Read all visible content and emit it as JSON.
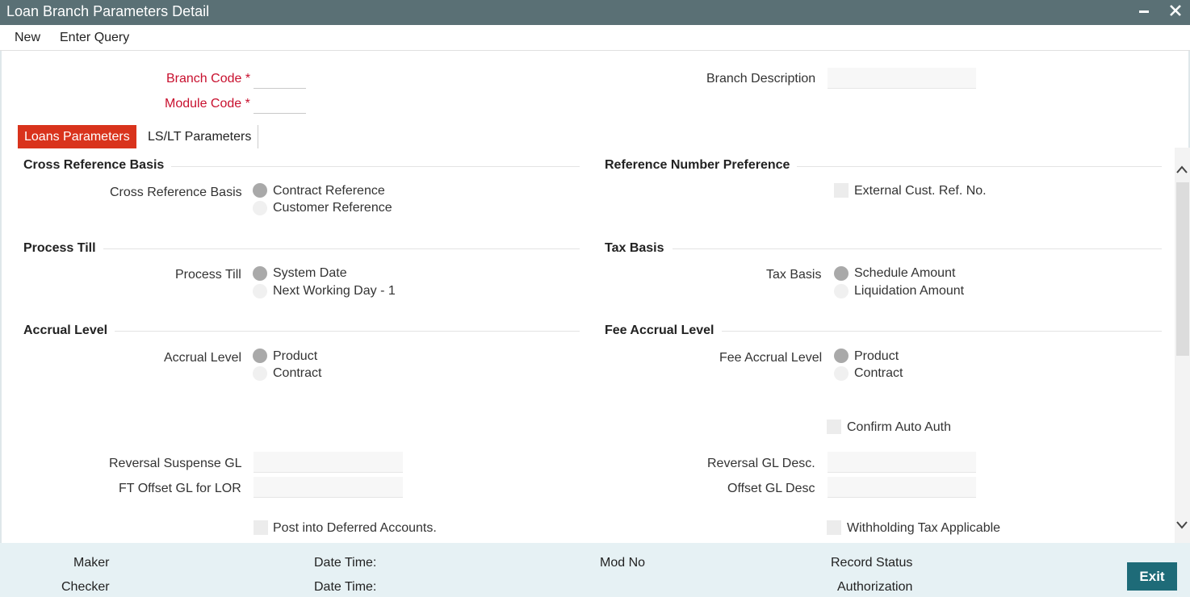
{
  "window": {
    "title": "Loan Branch Parameters Detail",
    "minimize": "−",
    "close": "✕"
  },
  "menu": {
    "new": "New",
    "enter_query": "Enter Query"
  },
  "header": {
    "branch_code_label": "Branch Code",
    "module_code_label": "Module Code",
    "required_mark": "*",
    "branch_description_label": "Branch Description",
    "branch_code_value": "",
    "module_code_value": "",
    "branch_description_value": ""
  },
  "tabs": [
    {
      "label": "Loans Parameters",
      "active": true
    },
    {
      "label": "LS/LT Parameters",
      "active": false
    }
  ],
  "sections": {
    "cross_reference": {
      "title": "Cross Reference Basis",
      "field_label": "Cross Reference Basis",
      "options": [
        "Contract Reference",
        "Customer Reference"
      ],
      "selected": "Contract Reference"
    },
    "reference_number": {
      "title": "Reference Number Preference",
      "checkbox_label": "External Cust. Ref. No."
    },
    "process_till": {
      "title": "Process Till",
      "field_label": "Process Till",
      "options": [
        "System Date",
        "Next Working Day - 1"
      ],
      "selected": "System Date"
    },
    "tax_basis": {
      "title": "Tax Basis",
      "field_label": "Tax Basis",
      "options": [
        "Schedule Amount",
        "Liquidation Amount"
      ],
      "selected": "Schedule Amount"
    },
    "accrual_level": {
      "title": "Accrual Level",
      "field_label": "Accrual Level",
      "options": [
        "Product",
        "Contract"
      ],
      "selected": "Product"
    },
    "fee_accrual_level": {
      "title": "Fee Accrual Level",
      "field_label": "Fee Accrual Level",
      "options": [
        "Product",
        "Contract"
      ],
      "selected": "Product"
    }
  },
  "fields": {
    "confirm_auto_auth": "Confirm Auto Auth",
    "reversal_suspense_gl": "Reversal Suspense GL",
    "ft_offset_gl": "FT Offset GL for LOR",
    "reversal_gl_desc": "Reversal GL Desc.",
    "offset_gl_desc": "Offset GL Desc",
    "post_deferred": "Post into Deferred Accounts.",
    "withholding_tax": "Withholding Tax Applicable"
  },
  "footer": {
    "maker": "Maker",
    "checker": "Checker",
    "date_time": "Date Time:",
    "mod_no": "Mod No",
    "record_status": "Record Status",
    "authorization": "Authorization",
    "exit": "Exit"
  },
  "icons": {
    "scroll_up": "chevron-up-icon",
    "scroll_down": "chevron-down-icon"
  }
}
